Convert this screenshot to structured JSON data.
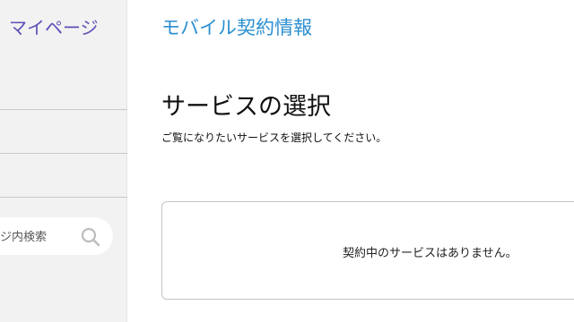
{
  "sidebar": {
    "title": "マイページ",
    "search": {
      "text": "ジ内検索",
      "icon": "search-icon"
    }
  },
  "main": {
    "app_title": "モバイル契約情報",
    "heading": "サービスの選択",
    "subtitle": "ご覧になりたいサービスを選択してください。",
    "empty_message": "契約中のサービスはありません。"
  },
  "colors": {
    "sidebar_title": "#5b4fb8",
    "app_title": "#2c8fd0",
    "sidebar_bg": "#f2f2f2"
  }
}
